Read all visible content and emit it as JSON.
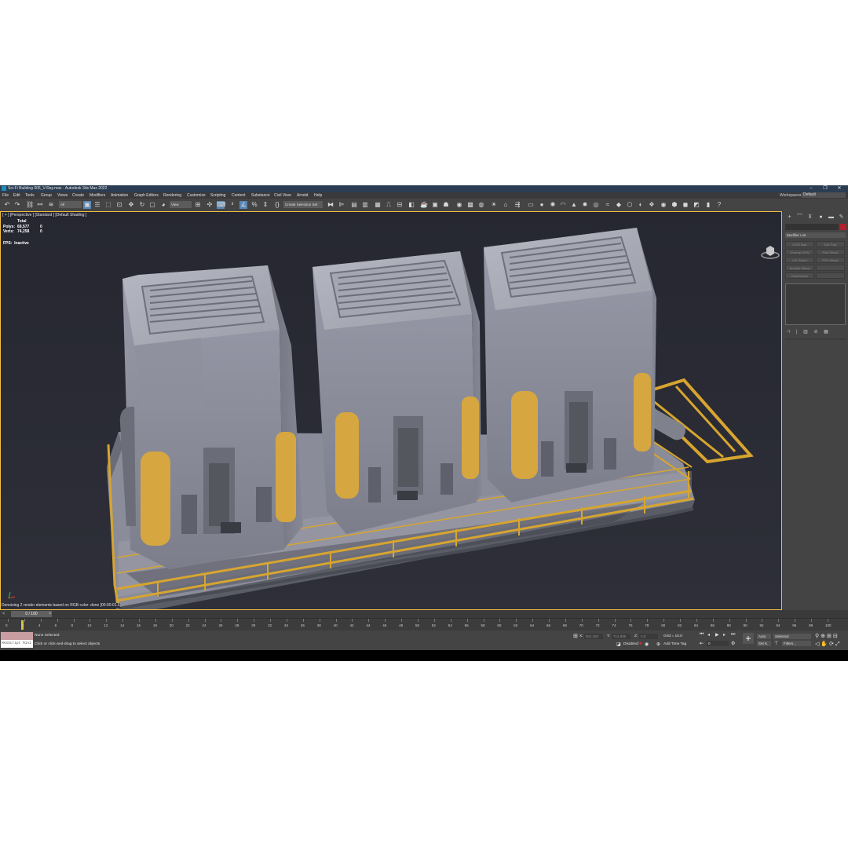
{
  "window": {
    "title": "Sci-Fi Building 006_V-Ray.max - Autodesk 3ds Max 2022",
    "controls": [
      "–",
      "❐",
      "✕"
    ]
  },
  "menu": {
    "items": [
      "File",
      "Edit",
      "Tools",
      "Group",
      "Views",
      "Create",
      "Modifiers",
      "Animation",
      "Graph Editors",
      "Rendering",
      "Customize",
      "Scripting",
      "Content",
      "Substance",
      "Civil View",
      "Arnold",
      "Help"
    ],
    "workspaces_label": "Workspaces:",
    "workspaces_value": "Default"
  },
  "toolbar": {
    "filter_value": "All",
    "view_value": "View",
    "selection_set": "Create Selection Set"
  },
  "viewport": {
    "label": "[ + ] [Perspective ] [Standard ] [Default Shading ]",
    "stats": {
      "header": "Total",
      "polys_label": "Polys:",
      "polys_value": "69,577",
      "polys_sel": "0",
      "verts_label": "Verts:",
      "verts_value": "74,258",
      "verts_sel": "0"
    },
    "fps_label": "FPS:",
    "fps_value": "Inactive",
    "message": "Denoising 2 render elements based on RGB color: done [00:00:01.6]"
  },
  "command_panel": {
    "modifier_list": "Modifier List",
    "buttons": [
      "UVW Map",
      "Edit Poly",
      "Unwrap UVW",
      "Poly Select",
      "Vol. Select",
      "FFD Select",
      "Surface Select",
      "",
      "PatchSelect",
      ""
    ]
  },
  "time_slider": {
    "position": "0 / 100",
    "left_arrow": "<",
    "right_arrow": ">"
  },
  "trackbar": {
    "ticks": [
      "0",
      "2",
      "4",
      "6",
      "8",
      "10",
      "12",
      "14",
      "16",
      "18",
      "20",
      "22",
      "24",
      "26",
      "28",
      "30",
      "32",
      "34",
      "36",
      "38",
      "40",
      "42",
      "44",
      "46",
      "48",
      "50",
      "52",
      "54",
      "56",
      "58",
      "60",
      "62",
      "64",
      "66",
      "68",
      "70",
      "72",
      "74",
      "76",
      "78",
      "80",
      "82",
      "84",
      "86",
      "88",
      "90",
      "92",
      "94",
      "96",
      "98",
      "100"
    ]
  },
  "status": {
    "maxscript": "MAXScript Mini",
    "selection": "None Selected",
    "prompt": "Click or click-and-drag to select objects",
    "x_label": "X:",
    "x_value": "801.293",
    "y_label": "Y:",
    "y_value": "712.895",
    "z_label": "Z:",
    "z_value": "0.0",
    "grid": "Grid = 10.0",
    "disabled": "Disabled:",
    "add_time_tag": "Add Time Tag",
    "auto": "Auto",
    "set_key": "Set K.",
    "selected": "Selected",
    "filters": "Filters...",
    "frame": "0"
  },
  "colors": {
    "title_bar": "#2b3d52",
    "ui_gray": "#444444",
    "viewport_bg": "#2a2b34",
    "viewport_border": "#f0c040",
    "active_button": "#5a87b4",
    "building_gray": "#8c8e9c",
    "building_accent": "#d6a640",
    "railing": "#d7a52f"
  }
}
